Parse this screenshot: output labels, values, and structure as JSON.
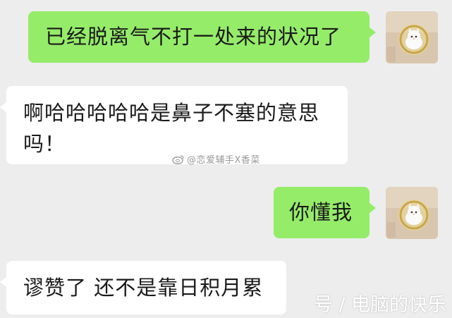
{
  "messages": [
    {
      "side": "out",
      "text": "已经脱离气不打一处来的状况了"
    },
    {
      "side": "in",
      "text": "啊哈哈哈哈哈是鼻子不塞的意思吗！"
    },
    {
      "side": "out",
      "text": "你懂我"
    },
    {
      "side": "in",
      "text": "谬赞了 还不是靠日积月累"
    }
  ],
  "watermark": {
    "mid": "@恋爱辅手X香菜",
    "corner": "号 / 电脑的快乐"
  },
  "icons": {
    "avatar": "cat-photo-avatar",
    "weibo": "weibo-logo-icon"
  },
  "colors": {
    "background": "#ededed",
    "outgoing_bubble": "#95ec69",
    "incoming_bubble": "#ffffff"
  }
}
